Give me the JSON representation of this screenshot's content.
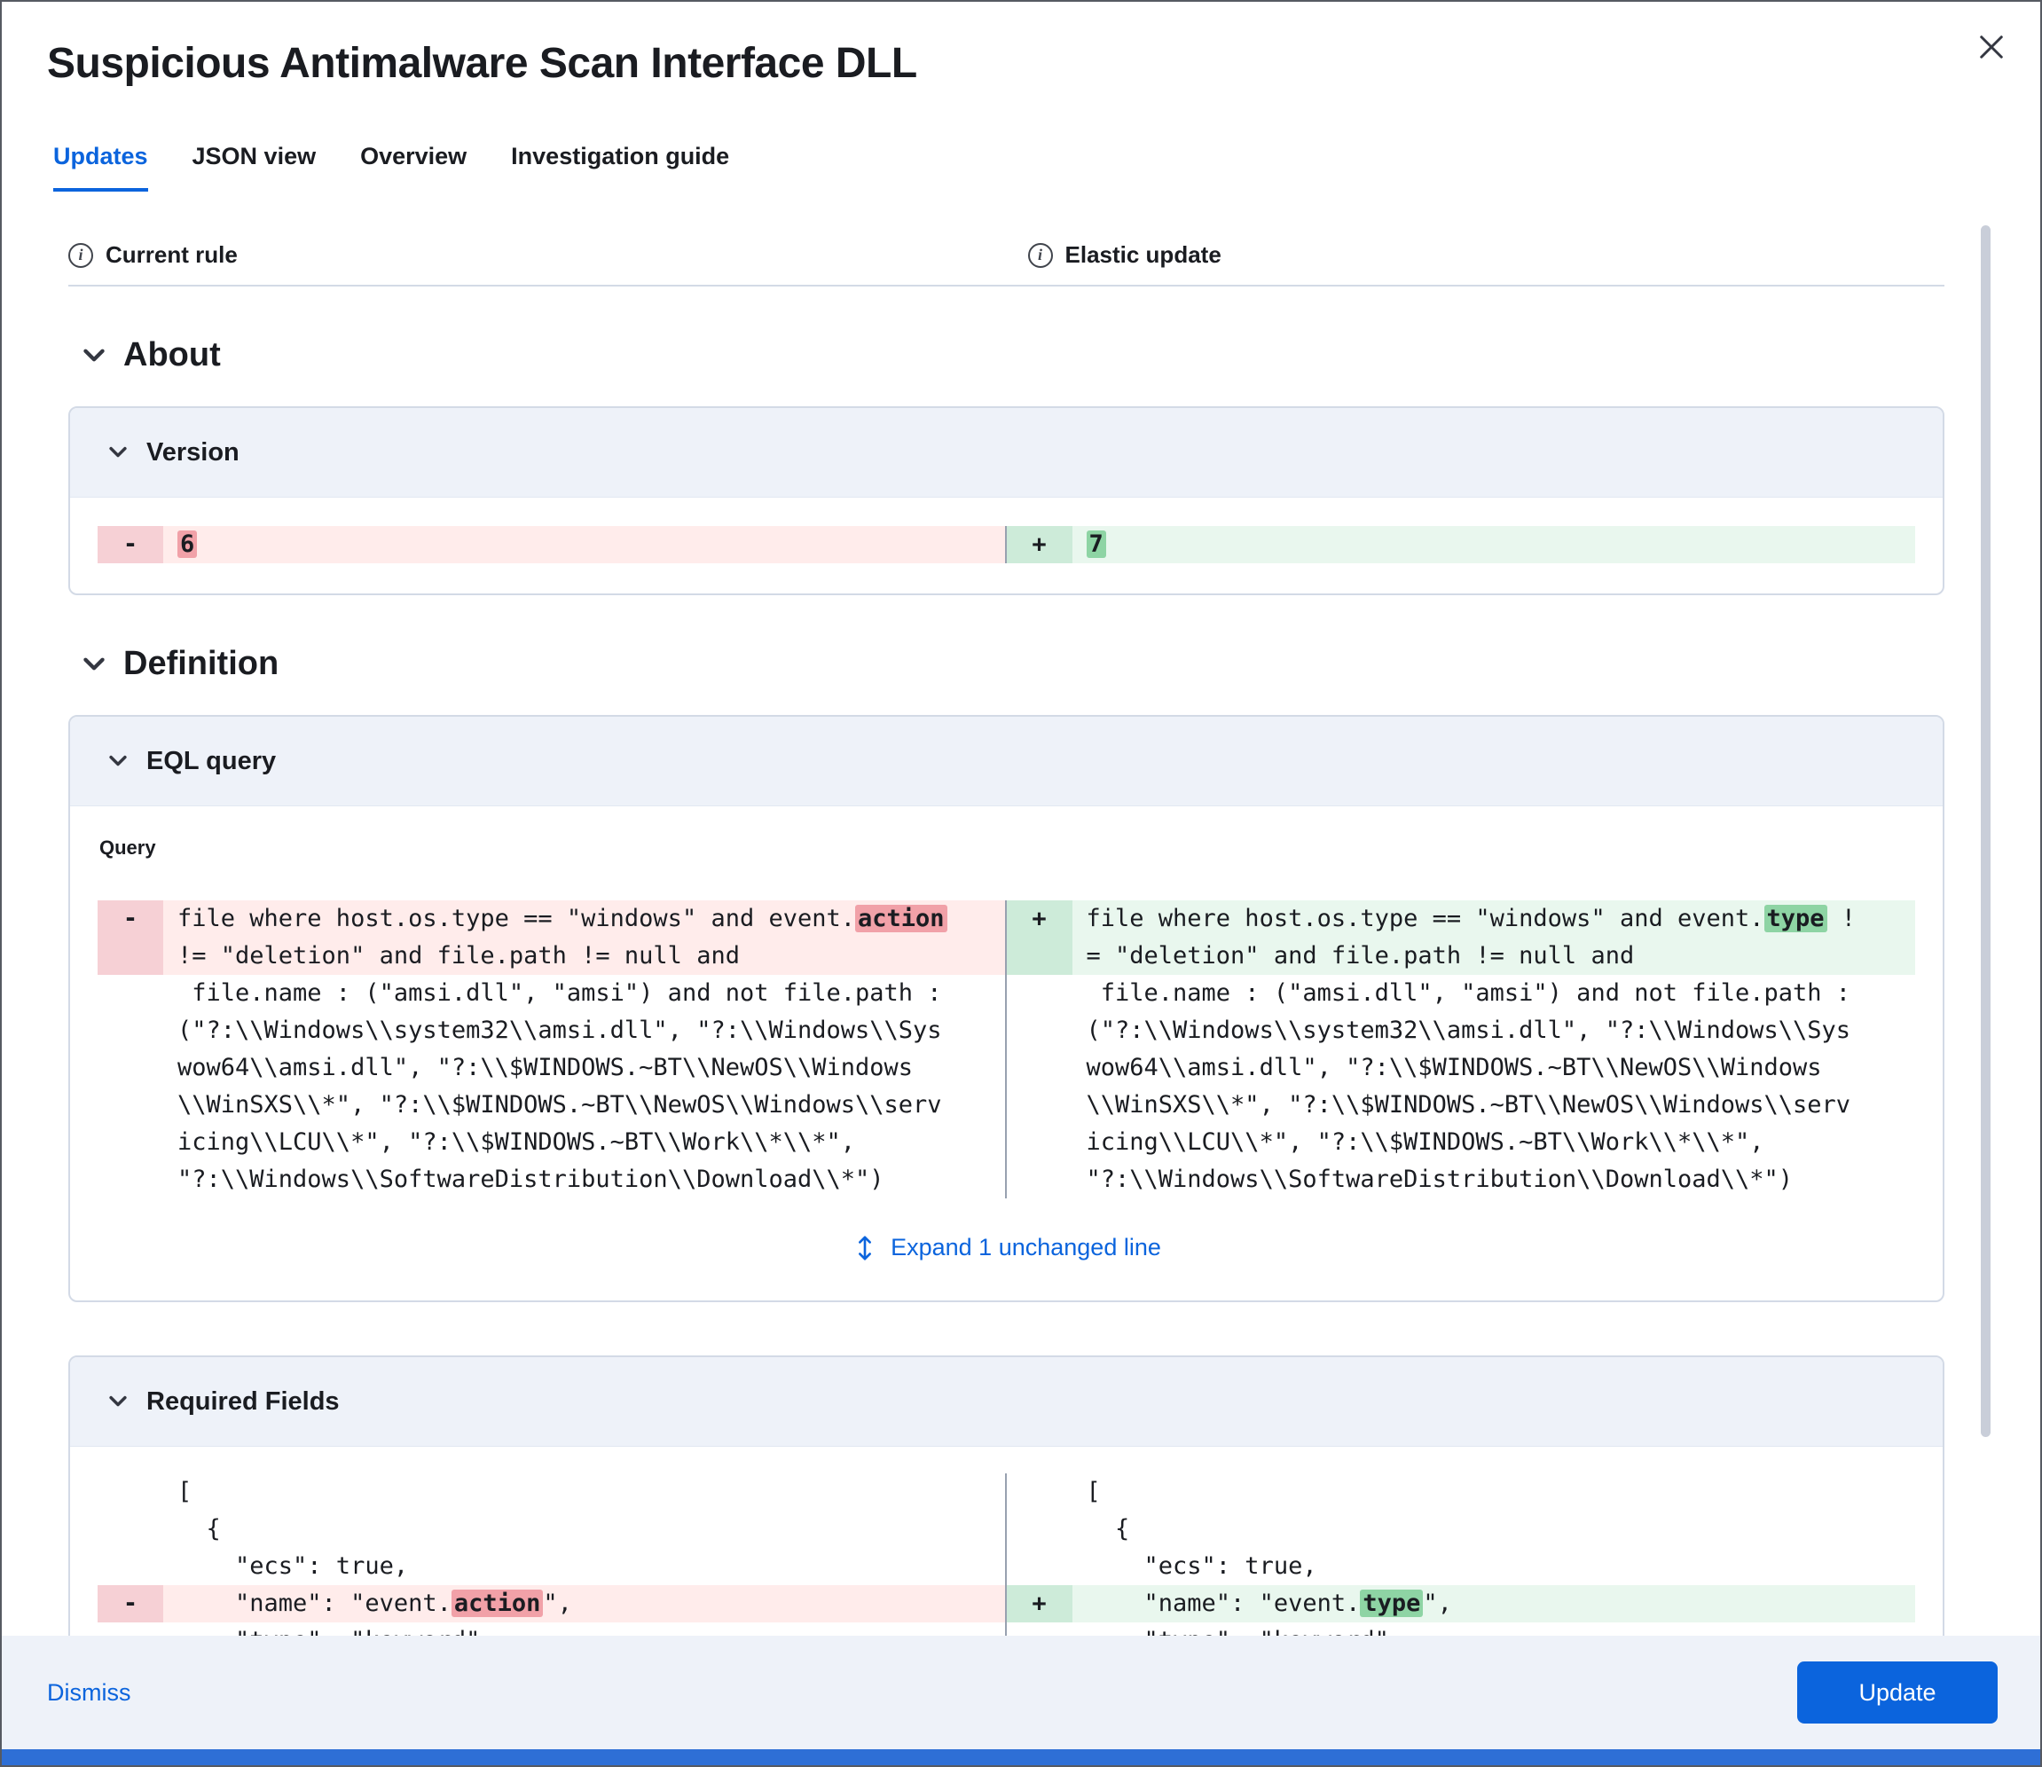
{
  "flyout": {
    "title": "Suspicious Antimalware Scan Interface DLL"
  },
  "tabs": {
    "updates": "Updates",
    "json_view": "JSON view",
    "overview": "Overview",
    "investigation_guide": "Investigation guide"
  },
  "diff_columns": {
    "current": "Current rule",
    "update": "Elastic update"
  },
  "sections": {
    "about": "About",
    "definition": "Definition"
  },
  "glyphs": {
    "minus": "-",
    "plus": "+",
    "info": "i"
  },
  "icons": {
    "close-icon": "x",
    "info-icon": "circled-i",
    "chevron-down-icon": "v",
    "expand-icon": "up-down-arrow"
  },
  "version": {
    "panel_title": "Version",
    "removed": "6",
    "added": "7"
  },
  "eql": {
    "panel_title": "EQL query",
    "query_label": "Query",
    "expand_link": "Expand 1 unchanged line",
    "left": {
      "l1_pre": "file where host.os.type == \"windows\" and event.",
      "l1_hl": "action",
      "l2": "!= \"deletion\" and file.path != null and",
      "l3": " file.name : (\"amsi.dll\", \"amsi\") and not file.path :",
      "l4": "(\"?:\\\\Windows\\\\system32\\\\amsi.dll\", \"?:\\\\Windows\\\\Sys",
      "l5": "wow64\\\\amsi.dll\", \"?:\\\\$WINDOWS.~BT\\\\NewOS\\\\Windows",
      "l6": "\\\\WinSXS\\\\*\", \"?:\\\\$WINDOWS.~BT\\\\NewOS\\\\Windows\\\\serv",
      "l7": "icing\\\\LCU\\\\*\", \"?:\\\\$WINDOWS.~BT\\\\Work\\\\*\\\\*\",",
      "l8": "\"?:\\\\Windows\\\\SoftwareDistribution\\\\Download\\\\*\")"
    },
    "right": {
      "l1_pre": "file where host.os.type == \"windows\" and event.",
      "l1_hl": "type",
      "l1_post": " !",
      "l2": "= \"deletion\" and file.path != null and",
      "l3": " file.name : (\"amsi.dll\", \"amsi\") and not file.path :",
      "l4": "(\"?:\\\\Windows\\\\system32\\\\amsi.dll\", \"?:\\\\Windows\\\\Sys",
      "l5": "wow64\\\\amsi.dll\", \"?:\\\\$WINDOWS.~BT\\\\NewOS\\\\Windows",
      "l6": "\\\\WinSXS\\\\*\", \"?:\\\\$WINDOWS.~BT\\\\NewOS\\\\Windows\\\\serv",
      "l7": "icing\\\\LCU\\\\*\", \"?:\\\\$WINDOWS.~BT\\\\Work\\\\*\\\\*\",",
      "l8": "\"?:\\\\Windows\\\\SoftwareDistribution\\\\Download\\\\*\")"
    }
  },
  "required_fields": {
    "panel_title": "Required Fields",
    "left": {
      "l1": "[",
      "l2": "  {",
      "l3": "    \"ecs\": true,",
      "l4_pre": "    \"name\": \"event.",
      "l4_hl": "action",
      "l4_post": "\",",
      "l5": "    \"type\": \"keyword\""
    },
    "right": {
      "l1": "[",
      "l2": "  {",
      "l3": "    \"ecs\": true,",
      "l4_pre": "    \"name\": \"event.",
      "l4_hl": "type",
      "l4_post": "\",",
      "l5": "    \"type\": \"keyword\""
    }
  },
  "footer": {
    "dismiss": "Dismiss",
    "update": "Update"
  },
  "colors": {
    "primary": "#0b64dd",
    "removed_line_bg": "#ffeceb",
    "removed_token_bg": "#f1a1a8",
    "added_line_bg": "#e9f7ee",
    "added_token_bg": "#8ed4a4",
    "panel_header_bg": "#eef2f9"
  }
}
